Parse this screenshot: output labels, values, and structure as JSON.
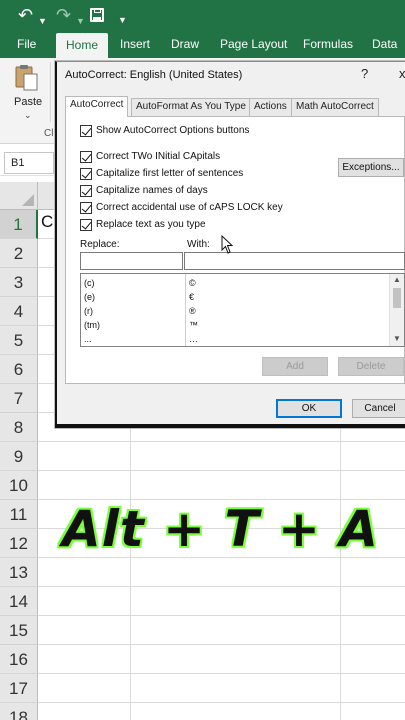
{
  "quick_access": {
    "undo_icon": "undo-icon",
    "redo_icon": "redo-icon",
    "save_icon": "save-icon",
    "customize_icon": "customize-icon"
  },
  "ribbon": {
    "tabs": [
      "File",
      "Home",
      "Insert",
      "Draw",
      "Page Layout",
      "Formulas",
      "Data"
    ],
    "active_tab": "Home",
    "paste_label": "Paste",
    "clipboard_label": "Cl"
  },
  "formula_bar": {
    "name_box": "B1"
  },
  "sheet": {
    "rows": [
      "1",
      "2",
      "3",
      "4",
      "5",
      "6",
      "7",
      "8",
      "9",
      "10",
      "11",
      "12",
      "13",
      "14",
      "15",
      "16",
      "17",
      "18"
    ],
    "selected_row": "1",
    "a1_value": "CY"
  },
  "overlay_text": "Alt + T + A",
  "dialog": {
    "title": "AutoCorrect: English (United States)",
    "help": "?",
    "close": "x",
    "tabs": [
      "AutoCorrect",
      "AutoFormat As You Type",
      "Actions",
      "Math AutoCorrect"
    ],
    "active_tab": "AutoCorrect",
    "show_options": "Show AutoCorrect Options buttons",
    "options": [
      "Correct TWo INitial CApitals",
      "Capitalize first letter of sentences",
      "Capitalize names of days",
      "Correct accidental use of cAPS LOCK key",
      "Replace text as you type"
    ],
    "exceptions_button": "Exceptions...",
    "replace_label": "Replace:",
    "with_label": "With:",
    "list": [
      {
        "replace": "(c)",
        "with": "©"
      },
      {
        "replace": "(e)",
        "with": "€"
      },
      {
        "replace": "(r)",
        "with": "®"
      },
      {
        "replace": "(tm)",
        "with": "™"
      },
      {
        "replace": "...",
        "with": "…"
      }
    ],
    "add_button": "Add",
    "delete_button": "Delete",
    "ok_button": "OK",
    "cancel_button": "Cancel"
  },
  "colors": {
    "excel_green": "#217346",
    "dialog_bg": "#f0f0f0",
    "overlay_outline": "#7aff3a"
  }
}
